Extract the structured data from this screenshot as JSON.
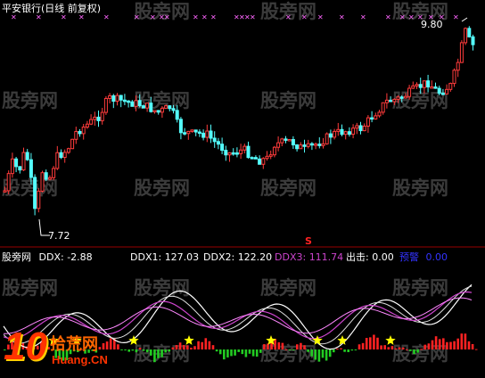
{
  "upper_panel": {
    "title": "平安银行(日线 前复权)",
    "high_label": "9.80",
    "low_label": "7.72",
    "signal_marker": "S",
    "watermark": "股旁网"
  },
  "lower_panel": {
    "title": "股旁网",
    "ddx_label": "DDX:",
    "ddx_value": "-2.88",
    "ddx1_label": "DDX1:",
    "ddx1_value": "127.03",
    "ddx2_label": "DDX2:",
    "ddx2_value": "122.20",
    "ddx3_label": "DDX3:",
    "ddx3_value": "111.74",
    "chuji_label": "出击:",
    "chuji_value": "0.00",
    "yujing_label": "预警",
    "yujing_value": "0.00"
  },
  "logo": {
    "big": "10",
    "cn": "拾荒网",
    "url": "Huang.CN"
  },
  "colors": {
    "background": "#000000",
    "up": "#ff3b3b",
    "down": "#54ffff",
    "title": "#ffffff",
    "ddx3": "#cc44cc",
    "yujing": "#3333ff",
    "separator": "#cc0000",
    "star": "#ffff00",
    "top_marks": "#ff66ff"
  }
}
